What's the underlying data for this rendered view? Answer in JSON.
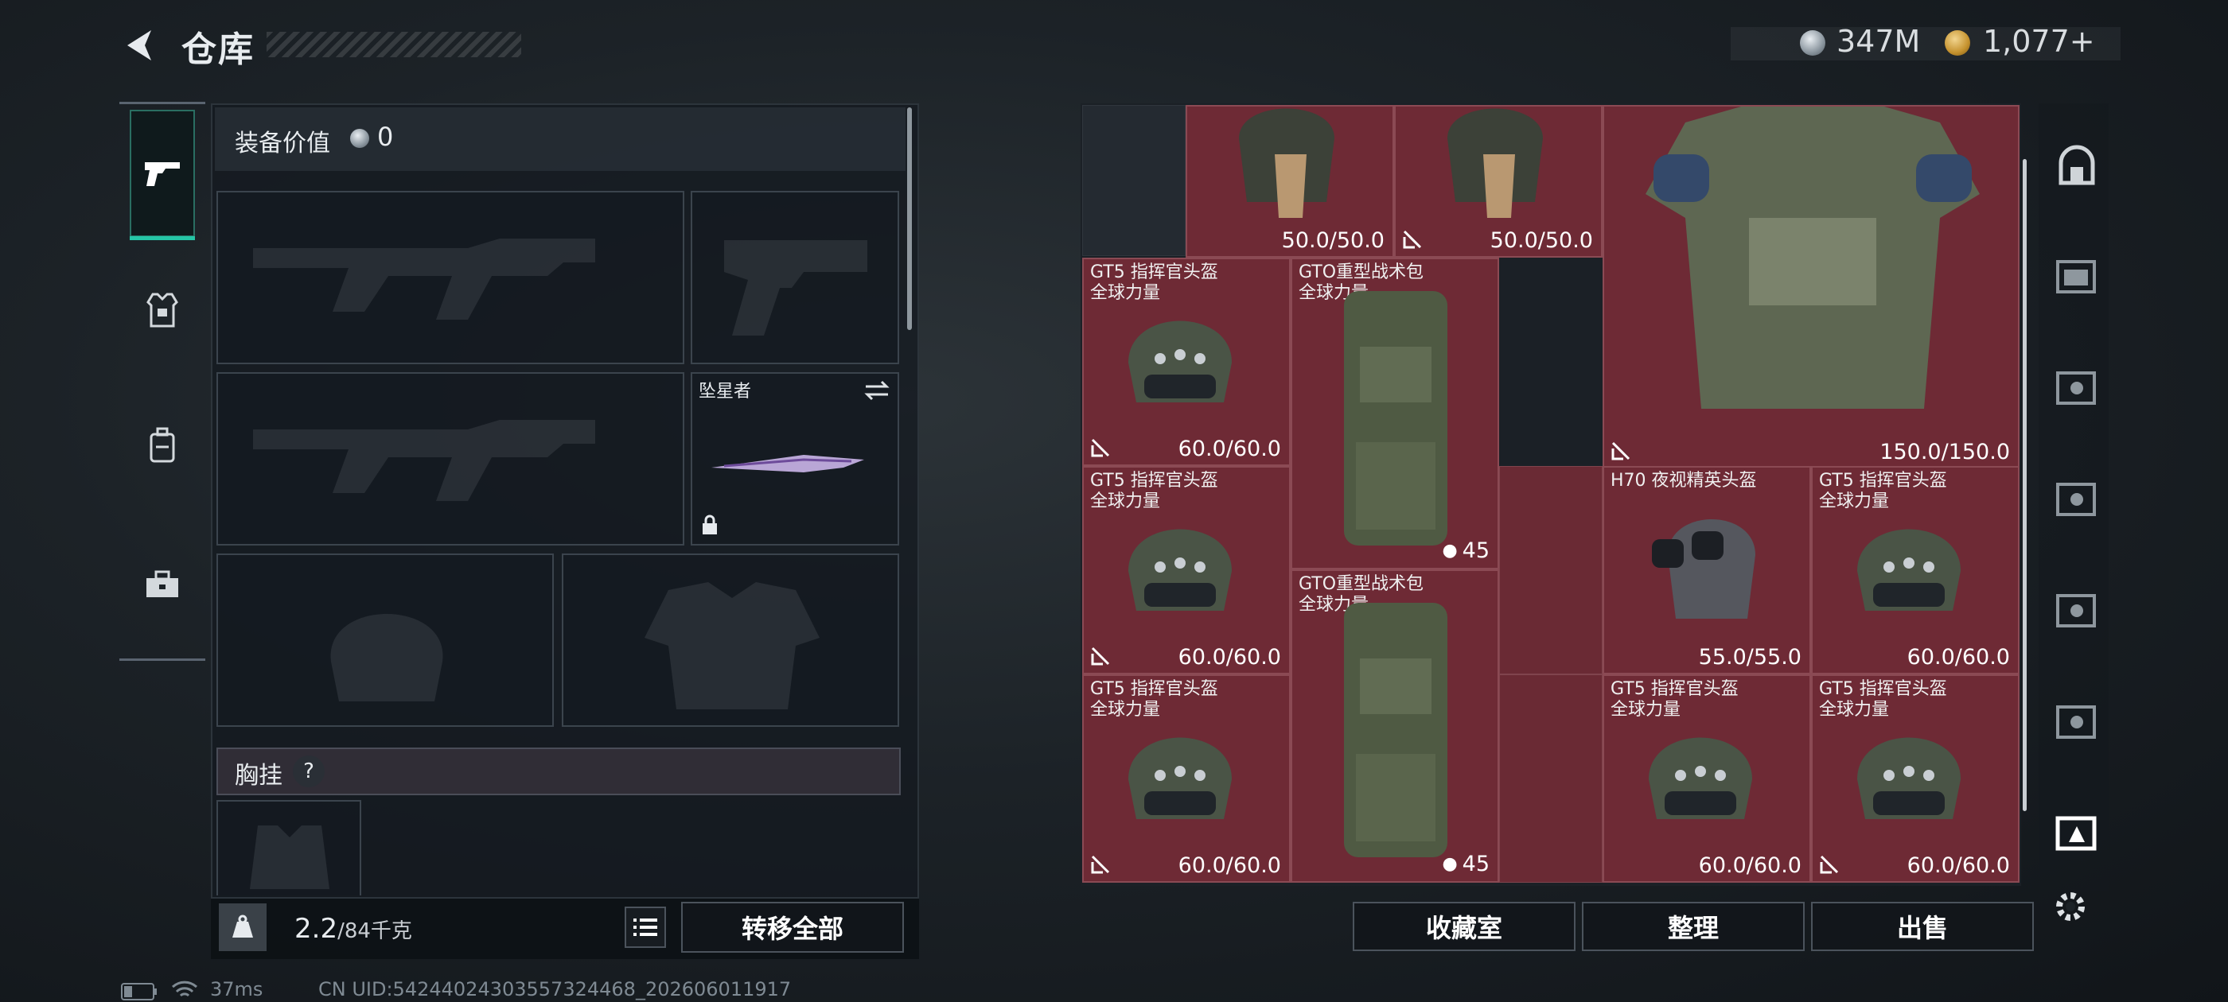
{
  "header": {
    "title": "仓库"
  },
  "currency": {
    "coins": "347M",
    "premium": "1,077",
    "premium_plus": "+"
  },
  "equip": {
    "value_label": "装备价值",
    "value": "0",
    "melee_name": "坠星者",
    "chest_label": "胸挂",
    "help": "?",
    "weight_current": "2.2",
    "weight_max": "/84千克",
    "transfer_all": "转移全部"
  },
  "warehouse": {
    "items": [
      {
        "name": "",
        "sub": "",
        "durability": "50.0/50.0",
        "locked": false
      },
      {
        "name": "",
        "sub": "",
        "durability": "50.0/50.0",
        "locked": true
      },
      {
        "name": "",
        "sub": "",
        "durability": "150.0/150.0",
        "locked": true
      },
      {
        "name": "GT5 指挥官头盔",
        "sub": "全球力量",
        "durability": "60.0/60.0",
        "locked": true
      },
      {
        "name": "GTO重型战术包",
        "sub": "全球力量",
        "count": "45"
      },
      {
        "name": "GT5 指挥官头盔",
        "sub": "全球力量",
        "durability": "60.0/60.0",
        "locked": true
      },
      {
        "name": "H70 夜视精英头盔",
        "sub": "",
        "durability": "55.0/55.0",
        "locked": false
      },
      {
        "name": "GT5 指挥官头盔",
        "sub": "全球力量",
        "durability": "60.0/60.0",
        "locked": false
      },
      {
        "name": "GTO重型战术包",
        "sub": "全球力量",
        "count": "45"
      },
      {
        "name": "GT5 指挥官头盔",
        "sub": "全球力量",
        "durability": "60.0/60.0",
        "locked": true
      },
      {
        "name": "GT5 指挥官头盔",
        "sub": "全球力量",
        "durability": "60.0/60.0",
        "locked": false
      },
      {
        "name": "GT5 指挥官头盔",
        "sub": "全球力量",
        "durability": "60.0/60.0",
        "locked": true
      }
    ],
    "actions": {
      "collection": "收藏室",
      "sort": "整理",
      "sell": "出售"
    }
  },
  "status_bar": {
    "ping": "37ms",
    "uid": "CN UID:54244024303557324468_202606011917"
  },
  "colors": {
    "accent": "#25c6a6",
    "item_bg": "#6e2a35",
    "panel": "#1b2026"
  },
  "icons": [
    "back-arrow-icon",
    "coin-icon",
    "premium-coin-icon",
    "pistol-icon",
    "armor-vest-icon",
    "backpack-icon",
    "toolbox-icon",
    "weight-icon",
    "list-icon",
    "swap-icon",
    "lock-icon",
    "battery-icon",
    "wifi-icon",
    "safe-icon",
    "settings-gear-icon"
  ]
}
